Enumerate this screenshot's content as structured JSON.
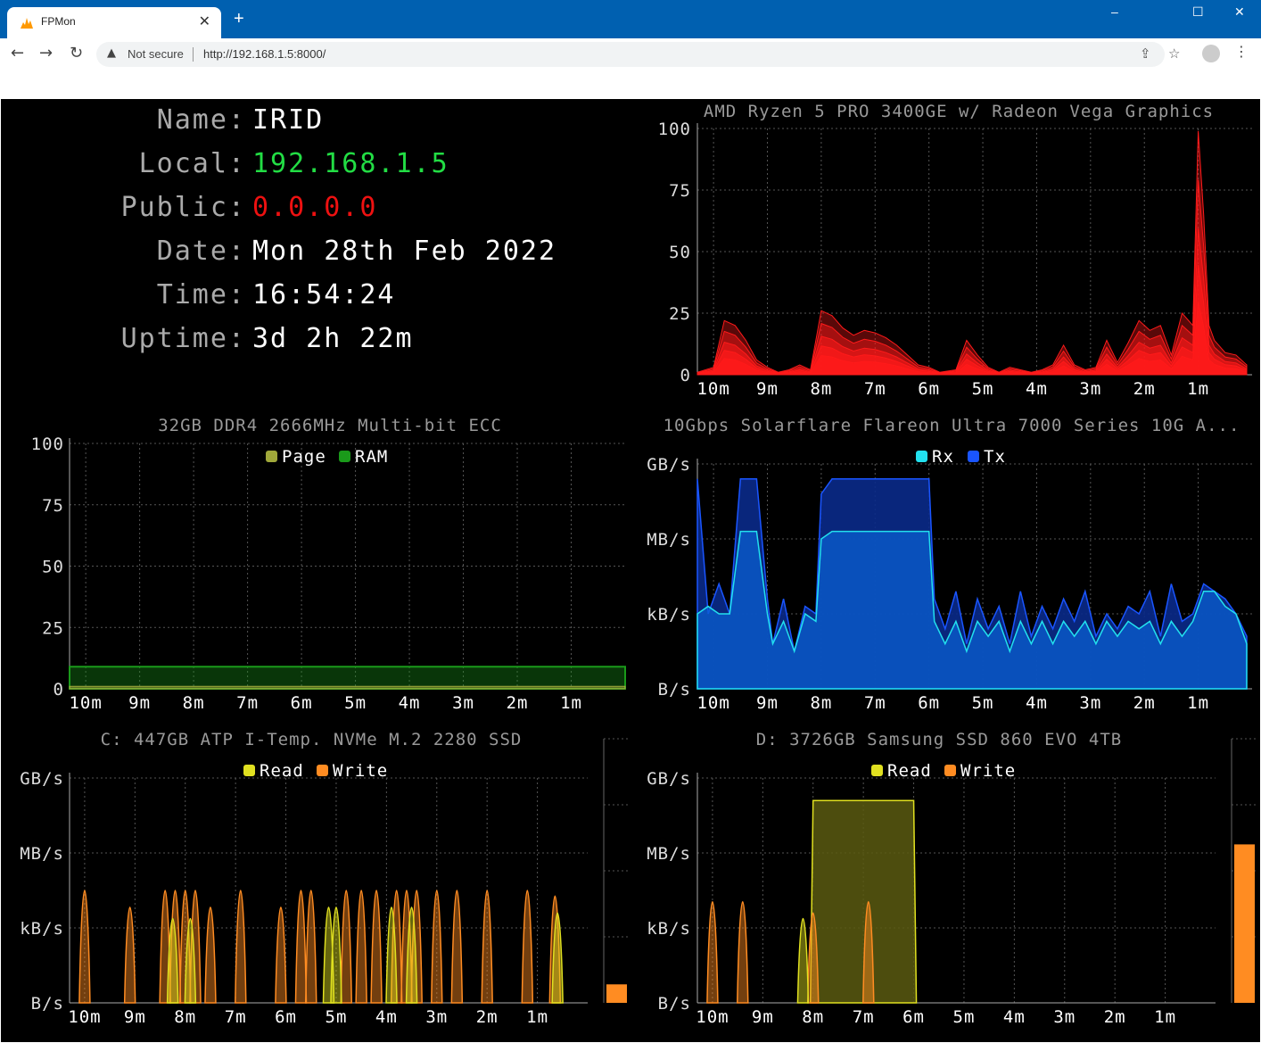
{
  "browser": {
    "tab_title": "FPMon",
    "tab_close": "✕",
    "new_tab": "+",
    "security_label": "Not secure",
    "url": "http://192.168.1.5:8000/",
    "window_controls": [
      "–",
      "☐",
      "✕"
    ]
  },
  "info": {
    "name_label": "Name:",
    "name_value": "IRID",
    "local_label": "Local:",
    "local_value": "192.168.1.5",
    "public_label": "Public:",
    "public_value": "0.0.0.0",
    "date_label": "Date:",
    "date_value": "Mon 28th Feb 2022",
    "time_label": "Time:",
    "time_value": "16:54:24",
    "uptime_label": "Uptime:",
    "uptime_value": "3d 2h 22m"
  },
  "colors": {
    "local_ip": "#22dd44",
    "public_ip": "#ee1111",
    "cpu": "#ff1a1a",
    "page": "#a0a83a",
    "ram": "#1a9a1a",
    "rx": "#22e0ee",
    "tx": "#1a55ff",
    "read": "#e0e020",
    "write": "#ff8c22"
  },
  "chart_data": [
    {
      "id": "cpu",
      "type": "area",
      "title": "AMD Ryzen 5 PRO 3400GE w/ Radeon Vega Graphics",
      "x_labels": [
        "10m",
        "9m",
        "8m",
        "7m",
        "6m",
        "5m",
        "4m",
        "3m",
        "2m",
        "1m"
      ],
      "y_labels": [
        "100",
        "75",
        "50",
        "25",
        "0"
      ],
      "ylim": [
        0,
        100
      ],
      "grid": true,
      "series": [
        {
          "x": [
            10.3,
            10.0,
            9.8,
            9.6,
            9.4,
            9.2,
            9.0,
            8.8,
            8.6,
            8.4,
            8.2,
            8.0,
            7.8,
            7.6,
            7.4,
            7.2,
            7.0,
            6.8,
            6.6,
            6.4,
            6.2,
            6.0,
            5.8,
            5.5,
            5.3,
            5.1,
            4.9,
            4.7,
            4.5,
            4.3,
            4.1,
            3.9,
            3.7,
            3.5,
            3.3,
            3.1,
            2.9,
            2.7,
            2.5,
            2.3,
            2.1,
            1.9,
            1.7,
            1.5,
            1.3,
            1.1,
            1.0,
            0.9,
            0.8,
            0.7,
            0.5,
            0.3,
            0.1
          ],
          "y": [
            1,
            3,
            22,
            20,
            14,
            6,
            3,
            1,
            2,
            4,
            2,
            26,
            24,
            19,
            16,
            18,
            17,
            15,
            12,
            8,
            4,
            3,
            1,
            2,
            14,
            8,
            3,
            1,
            3,
            2,
            1,
            2,
            4,
            12,
            4,
            2,
            3,
            14,
            5,
            13,
            22,
            18,
            20,
            8,
            25,
            20,
            99,
            65,
            20,
            14,
            9,
            8,
            4
          ]
        }
      ]
    },
    {
      "id": "memory",
      "type": "area",
      "title": "32GB DDR4 2666MHz Multi-bit ECC",
      "legend": [
        "Page",
        "RAM"
      ],
      "legend_position": "top-center",
      "x_labels": [
        "10m",
        "9m",
        "8m",
        "7m",
        "6m",
        "5m",
        "4m",
        "3m",
        "2m",
        "1m"
      ],
      "y_labels": [
        "100",
        "75",
        "50",
        "25",
        "0"
      ],
      "ylim": [
        0,
        100
      ],
      "grid": true,
      "series": [
        {
          "name": "Page",
          "x": [
            10.3,
            0
          ],
          "y": [
            1,
            1
          ]
        },
        {
          "name": "RAM",
          "x": [
            10.3,
            0
          ],
          "y": [
            9,
            9
          ]
        }
      ]
    },
    {
      "id": "network",
      "type": "area",
      "title": "10Gbps Solarflare Flareon Ultra 7000 Series 10G A...",
      "legend": [
        "Rx",
        "Tx"
      ],
      "legend_position": "top-center",
      "x_labels": [
        "10m",
        "9m",
        "8m",
        "7m",
        "6m",
        "5m",
        "4m",
        "3m",
        "2m",
        "1m"
      ],
      "y_labels": [
        "GB/s",
        "MB/s",
        "kB/s",
        "B/s"
      ],
      "scale": "log",
      "grid": true,
      "series": [
        {
          "name": "Rx",
          "x": [
            10.3,
            10.1,
            9.9,
            9.7,
            9.5,
            9.4,
            9.2,
            9.0,
            8.9,
            8.7,
            8.5,
            8.3,
            8.1,
            8.0,
            7.8,
            7.5,
            7.0,
            6.5,
            6.0,
            5.9,
            5.7,
            5.5,
            5.3,
            5.1,
            4.9,
            4.7,
            4.5,
            4.3,
            4.1,
            3.9,
            3.7,
            3.5,
            3.3,
            3.1,
            2.9,
            2.7,
            2.5,
            2.3,
            2.1,
            1.9,
            1.7,
            1.5,
            1.3,
            1.1,
            0.9,
            0.7,
            0.5,
            0.3,
            0.1
          ],
          "y": [
            1.0,
            1.1,
            1.0,
            1.0,
            2.1,
            2.1,
            2.1,
            1.0,
            0.6,
            0.9,
            0.5,
            1.0,
            0.9,
            2.0,
            2.1,
            2.1,
            2.1,
            2.1,
            2.1,
            0.9,
            0.6,
            0.9,
            0.5,
            0.9,
            0.7,
            0.9,
            0.5,
            0.9,
            0.6,
            0.9,
            0.6,
            0.9,
            0.7,
            0.9,
            0.6,
            0.9,
            0.7,
            0.9,
            0.8,
            0.9,
            0.6,
            0.9,
            0.7,
            0.9,
            1.3,
            1.3,
            1.1,
            1.0,
            0.6
          ]
        },
        {
          "name": "Tx",
          "x": [
            10.3,
            10.1,
            9.9,
            9.7,
            9.5,
            9.4,
            9.2,
            9.0,
            8.9,
            8.7,
            8.5,
            8.3,
            8.1,
            8.0,
            7.8,
            7.5,
            7.0,
            6.5,
            6.0,
            5.9,
            5.7,
            5.5,
            5.3,
            5.1,
            4.9,
            4.7,
            4.5,
            4.3,
            4.1,
            3.9,
            3.7,
            3.5,
            3.3,
            3.1,
            2.9,
            2.7,
            2.5,
            2.3,
            2.1,
            1.9,
            1.7,
            1.5,
            1.3,
            1.1,
            0.9,
            0.7,
            0.5,
            0.3,
            0.1
          ],
          "y": [
            2.8,
            1.0,
            1.4,
            1.0,
            2.8,
            2.8,
            2.8,
            1.2,
            0.6,
            1.2,
            0.5,
            1.1,
            1.0,
            2.6,
            2.8,
            2.8,
            2.8,
            2.8,
            2.8,
            1.2,
            0.8,
            1.3,
            0.6,
            1.2,
            0.8,
            1.1,
            0.6,
            1.3,
            0.7,
            1.1,
            0.8,
            1.2,
            0.9,
            1.3,
            0.7,
            1.0,
            0.8,
            1.1,
            1.0,
            1.3,
            0.7,
            1.4,
            0.9,
            1.0,
            1.4,
            1.3,
            1.2,
            1.0,
            0.7
          ]
        }
      ]
    },
    {
      "id": "disk-c",
      "type": "area",
      "title": "C: 447GB ATP I-Temp. NVMe M.2 2280 SSD",
      "legend": [
        "Read",
        "Write"
      ],
      "legend_position": "top-center",
      "x_labels": [
        "10m",
        "9m",
        "8m",
        "7m",
        "6m",
        "5m",
        "4m",
        "3m",
        "2m",
        "1m"
      ],
      "y_labels": [
        "GB/s",
        "MB/s",
        "kB/s",
        "B/s"
      ],
      "scale": "log",
      "grid": true,
      "usage_bar": 0.07,
      "series": [
        {
          "name": "Read",
          "spikes": [
            [
              8.25,
              1.5
            ],
            [
              7.9,
              1.5
            ],
            [
              5.15,
              1.7
            ],
            [
              5.0,
              1.7
            ],
            [
              3.9,
              1.7
            ],
            [
              3.5,
              1.7
            ],
            [
              0.6,
              1.6
            ]
          ]
        },
        {
          "name": "Write",
          "spikes": [
            [
              10.0,
              2.0
            ],
            [
              9.1,
              1.7
            ],
            [
              8.4,
              2.0
            ],
            [
              8.2,
              2.0
            ],
            [
              8.0,
              2.0
            ],
            [
              7.8,
              2.0
            ],
            [
              7.5,
              1.7
            ],
            [
              6.9,
              2.0
            ],
            [
              6.1,
              1.7
            ],
            [
              5.7,
              2.0
            ],
            [
              5.5,
              2.0
            ],
            [
              4.8,
              2.0
            ],
            [
              4.5,
              2.0
            ],
            [
              4.2,
              2.0
            ],
            [
              3.8,
              2.0
            ],
            [
              3.6,
              2.0
            ],
            [
              3.4,
              2.0
            ],
            [
              3.0,
              2.0
            ],
            [
              2.6,
              2.0
            ],
            [
              2.0,
              2.0
            ],
            [
              1.2,
              2.0
            ],
            [
              0.65,
              1.9
            ]
          ]
        }
      ]
    },
    {
      "id": "disk-d",
      "type": "area",
      "title": "D: 3726GB Samsung SSD 860 EVO 4TB",
      "legend": [
        "Read",
        "Write"
      ],
      "legend_position": "top-center",
      "x_labels": [
        "10m",
        "9m",
        "8m",
        "7m",
        "6m",
        "5m",
        "4m",
        "3m",
        "2m",
        "1m"
      ],
      "y_labels": [
        "GB/s",
        "MB/s",
        "kB/s",
        "B/s"
      ],
      "scale": "log",
      "grid": true,
      "usage_bar": 0.6,
      "series": [
        {
          "name": "Read",
          "block": [
            8.0,
            6.0,
            2.7
          ],
          "spikes": [
            [
              8.2,
              1.5
            ]
          ]
        },
        {
          "name": "Write",
          "spikes": [
            [
              10.0,
              1.8
            ],
            [
              9.4,
              1.8
            ],
            [
              8.0,
              1.6
            ],
            [
              6.9,
              1.8
            ]
          ]
        }
      ]
    }
  ]
}
